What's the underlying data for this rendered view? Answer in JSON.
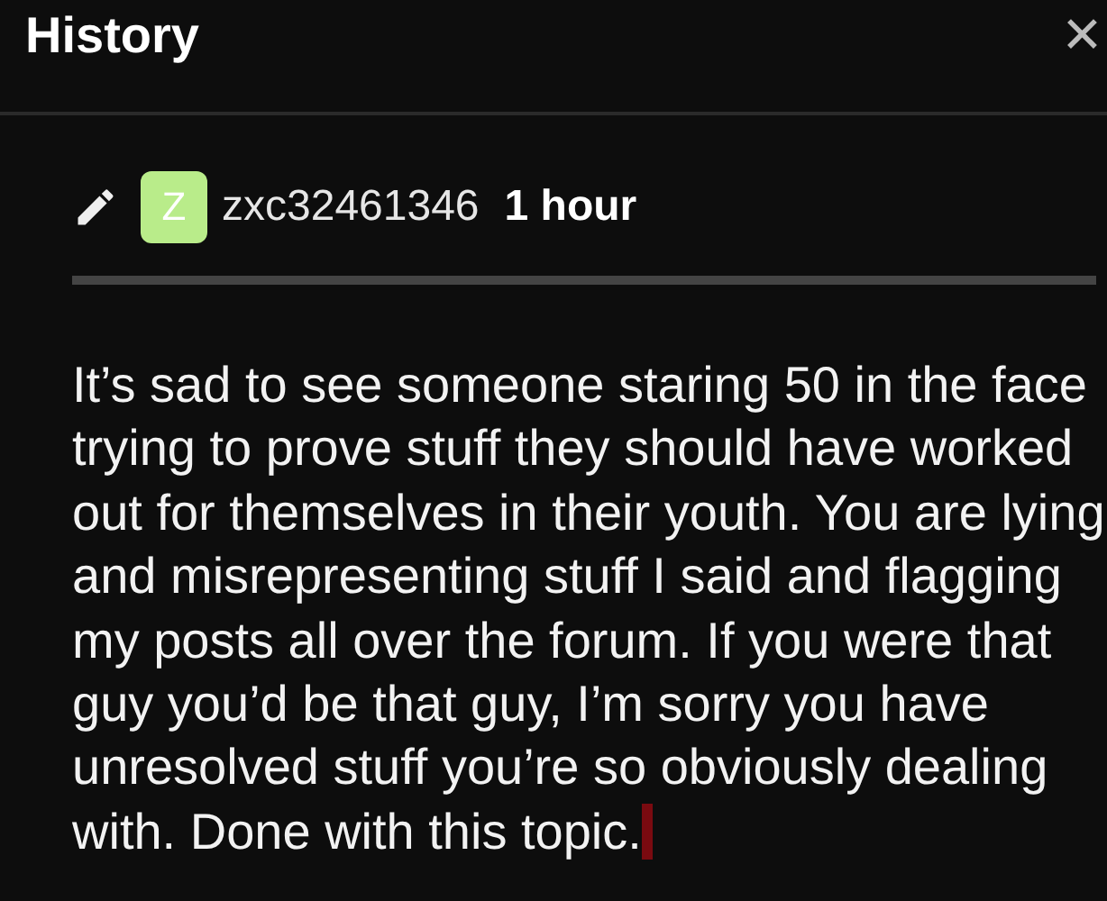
{
  "window": {
    "title": "History",
    "close": "✕"
  },
  "revision": {
    "avatar_letter": "Z",
    "username": "zxc32461346",
    "age": "1 hour"
  },
  "body": "It’s sad to see someone staring 50 in the face trying to prove stuff they should have worked out for themselves in their youth. You are lying and misrepresenting stuff I said and flagging my posts all over the forum. If you were that guy you’d be that guy, I’m sorry you have unresolved stuff you’re so obviously dealing with. Done with this topic."
}
